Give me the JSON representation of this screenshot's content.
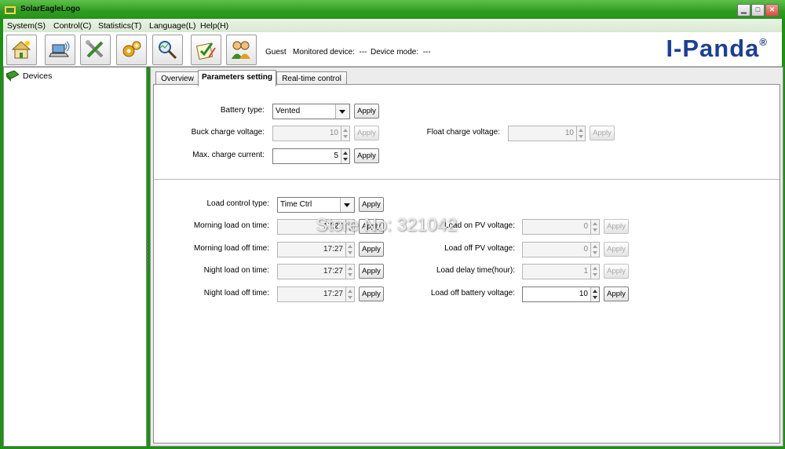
{
  "window": {
    "title": "SolarEagleLogo"
  },
  "menu": [
    "System(S)",
    "Control(C)",
    "Statistics(T)",
    "Language(L)",
    "Help(H)"
  ],
  "status": {
    "user": "Guest",
    "monitored_device": "Monitored device:  ---",
    "device_mode": "Device mode:  ---"
  },
  "logo": {
    "text": "I-Panda",
    "reg": "®"
  },
  "tree": {
    "root": "Devices"
  },
  "tabs": [
    "Overview",
    "Parameters setting",
    "Real-time control"
  ],
  "battery": {
    "battery_type_label": "Battery type:",
    "battery_type_value": "Vented",
    "buck_label": "Buck charge voltage:",
    "buck_value": "10",
    "float_label": "Float charge voltage:",
    "float_value": "10",
    "max_current_label": "Max. charge current:",
    "max_current_value": "5"
  },
  "load": {
    "control_type_label": "Load control type:",
    "control_type_value": "Time Ctrl",
    "morning_on_label": "Morning load on time:",
    "morning_on_value": "17:27",
    "morning_off_label": "Morning load off time:",
    "morning_off_value": "17:27",
    "night_on_label": "Night load on time:",
    "night_on_value": "17:27",
    "night_off_label": "Night load off time:",
    "night_off_value": "17:27",
    "pv_on_label": "Load on PV voltage:",
    "pv_on_value": "0",
    "pv_off_label": "Load off PV voltage:",
    "pv_off_value": "0",
    "delay_label": "Load delay time(hour):",
    "delay_value": "1",
    "battery_off_label": "Load off battery voltage:",
    "battery_off_value": "10"
  },
  "apply_label": "Apply",
  "watermark": "Store No: 321042",
  "colors": {
    "frame": "#1f8f16",
    "logo": "#1d3f93"
  }
}
